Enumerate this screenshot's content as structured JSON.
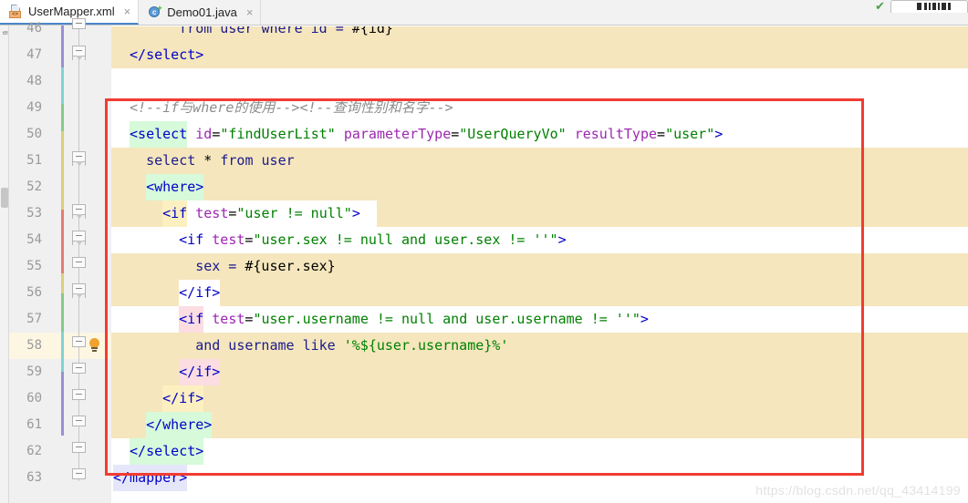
{
  "window": {
    "app": "IntelliJ IDEA XML Editor"
  },
  "tabs": [
    {
      "label": "UserMapper.xml",
      "icon": "xml-file-icon",
      "icon_badge": "<>",
      "close": "×",
      "active": true
    },
    {
      "label": "Demo01.java",
      "icon": "java-class-icon",
      "icon_letter": "c",
      "close": "×",
      "active": false
    }
  ],
  "toolbar_right": {
    "inspection_status_icon": "green-check-icon",
    "inspection_status_glyph": "✔",
    "run_widget_partial": "Demo"
  },
  "left_tool_strip": {
    "label": "ti"
  },
  "editor": {
    "current_line": 58,
    "first_visible_line": 46,
    "last_visible_line": 63,
    "lines": [
      {
        "num": 46,
        "indent": 8,
        "text": "from user where id = #{id}",
        "clipped": true
      },
      {
        "num": 47,
        "indent": 2,
        "text": "</select>"
      },
      {
        "num": 48,
        "indent": 0,
        "text": ""
      },
      {
        "num": 49,
        "indent": 2,
        "text": "<!--if与where的使用--><!--查询性别和名字-->"
      },
      {
        "num": 50,
        "indent": 2,
        "text": "<select id=\"findUserList\" parameterType=\"UserQueryVo\" resultType=\"user\">"
      },
      {
        "num": 51,
        "indent": 4,
        "text": "select * from user"
      },
      {
        "num": 52,
        "indent": 4,
        "text": "<where>"
      },
      {
        "num": 53,
        "indent": 6,
        "text": "<if test=\"user != null\">"
      },
      {
        "num": 54,
        "indent": 8,
        "text": "<if test=\"user.sex != null and user.sex != ''\">"
      },
      {
        "num": 55,
        "indent": 10,
        "text": "sex = #{user.sex}"
      },
      {
        "num": 56,
        "indent": 8,
        "text": "</if>"
      },
      {
        "num": 57,
        "indent": 8,
        "text": "<if test=\"user.username != null and user.username != ''\">"
      },
      {
        "num": 58,
        "indent": 10,
        "text": "and username like '%${user.username}%'"
      },
      {
        "num": 59,
        "indent": 8,
        "text": "</if>"
      },
      {
        "num": 60,
        "indent": 6,
        "text": "</if>"
      },
      {
        "num": 61,
        "indent": 4,
        "text": "</where>"
      },
      {
        "num": 62,
        "indent": 2,
        "text": "</select>"
      },
      {
        "num": 63,
        "indent": 0,
        "text": "</mapper>"
      }
    ]
  },
  "annotation": {
    "shape": "rectangle",
    "color": "#f23c32",
    "covers_lines": "49-62"
  },
  "watermark": {
    "text": "https://blog.csdn.net/qq_43414199"
  },
  "colors": {
    "tag": "#0000c8",
    "attribute": "#9c27b0",
    "attribute_value": "#008000",
    "comment": "#8c8c8c",
    "plain_sql": "#1a1a8c",
    "line_number": "#999999",
    "gutter_bg": "#f0f0f0",
    "code_bg_highlight": "#f5e6bd",
    "current_line_bg": "#fdf6e3",
    "annotation_red": "#f23c32",
    "tag_match_bg": "#d6fada",
    "brace_match_bg": "#fdf0c0",
    "pink_match_bg": "#fbdde2"
  }
}
